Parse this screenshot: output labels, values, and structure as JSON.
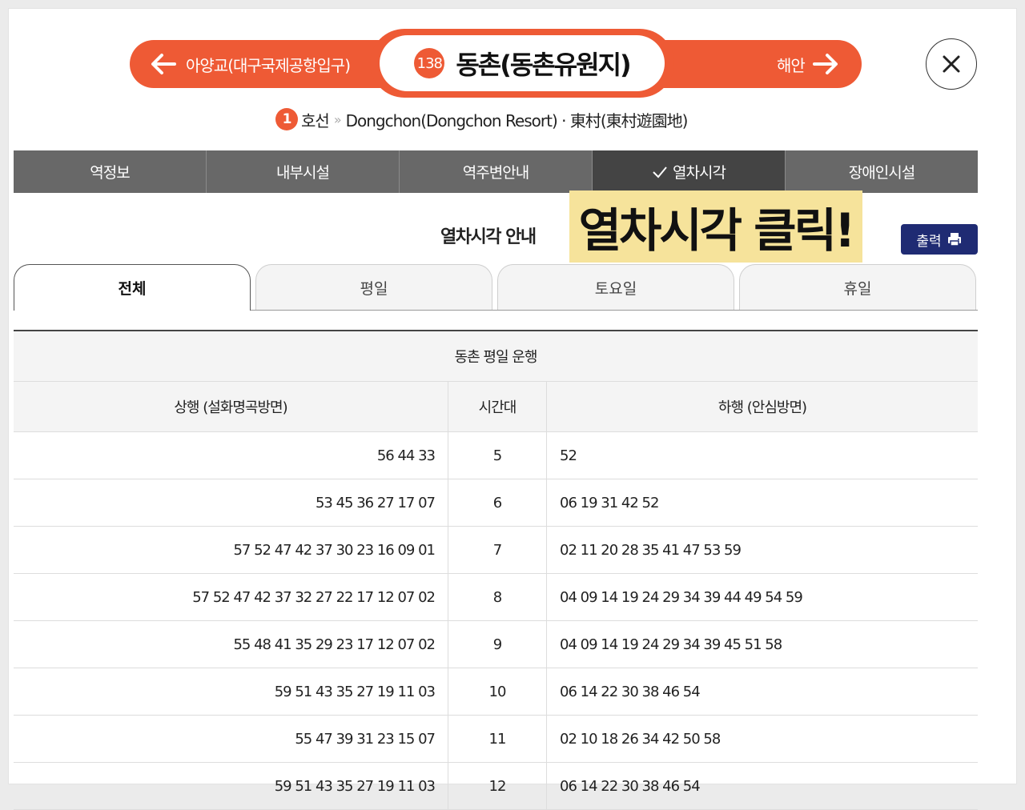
{
  "header": {
    "prev_station": "아양교(대구국제공항입구)",
    "next_station": "해안",
    "station_number": "138",
    "station_name": "동촌(동촌유원지)",
    "line_number": "1",
    "line_label": "호선",
    "station_subtitle": "Dongchon(Dongchon Resort) · 東村(東村遊園地)"
  },
  "main_tabs": [
    {
      "label": "역정보"
    },
    {
      "label": "내부시설"
    },
    {
      "label": "역주변안내"
    },
    {
      "label": "열차시각",
      "active": true
    },
    {
      "label": "장애인시설"
    }
  ],
  "section": {
    "title": "열차시각 안내",
    "callout": "열차시각 클릭!",
    "print_label": "출력"
  },
  "day_tabs": [
    {
      "label": "전체",
      "active": true
    },
    {
      "label": "평일"
    },
    {
      "label": "토요일"
    },
    {
      "label": "휴일"
    }
  ],
  "timetable": {
    "caption": "동촌 평일 운행",
    "headers": [
      "상행 (설화명곡방면)",
      "시간대",
      "하행 (안심방면)"
    ],
    "rows": [
      {
        "up": "56 44 33",
        "hour": "5",
        "down": "52"
      },
      {
        "up": "53 45 36 27 17 07",
        "hour": "6",
        "down": "06 19 31 42 52"
      },
      {
        "up": "57 52 47 42 37 30 23 16 09 01",
        "hour": "7",
        "down": "02 11 20 28 35 41 47 53 59"
      },
      {
        "up": "57 52 47 42 37 32 27 22 17 12 07 02",
        "hour": "8",
        "down": "04 09 14 19 24 29 34 39 44 49 54 59"
      },
      {
        "up": "55 48 41 35 29 23 17 12 07 02",
        "hour": "9",
        "down": "04 09 14 19 24 29 34 39 45 51 58"
      },
      {
        "up": "59 51 43 35 27 19 11 03",
        "hour": "10",
        "down": "06 14 22 30 38 46 54"
      },
      {
        "up": "55 47 39 31 23 15 07",
        "hour": "11",
        "down": "02 10 18 26 34 42 50 58"
      },
      {
        "up": "59 51 43 35 27 19 11 03",
        "hour": "12",
        "down": "06 14 22 30 38 46 54"
      }
    ]
  },
  "colors": {
    "accent": "#ee5a35",
    "tab_bg": "#686868",
    "tab_active": "#444444",
    "print_button": "#1f2b73",
    "callout_bg": "#f6e39b"
  }
}
